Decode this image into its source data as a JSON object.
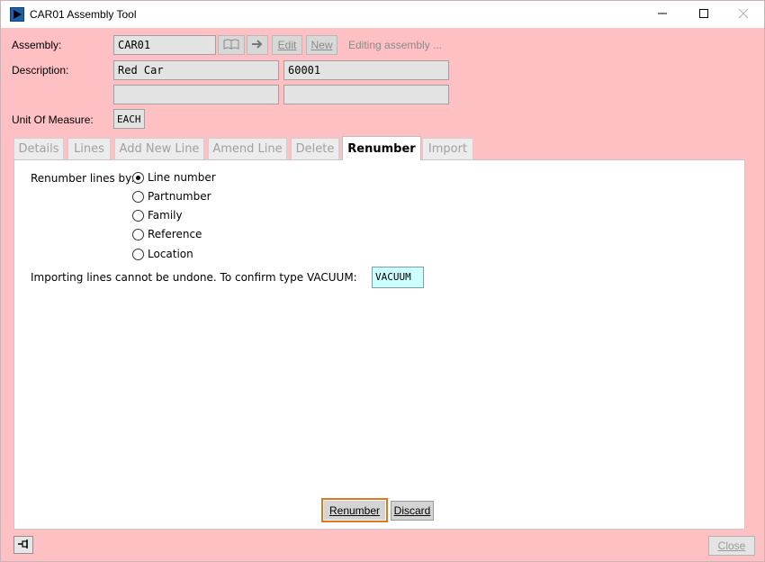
{
  "window": {
    "title": "CAR01 Assembly Tool",
    "app_icon": "play-icon",
    "controls": [
      "minimize-icon",
      "maximize-icon",
      "close-icon"
    ]
  },
  "header": {
    "assembly_label": "Assembly:",
    "assembly_value": "CAR01",
    "description_label": "Description:",
    "description_value": "Red Car",
    "code_value": "60001",
    "extra1_value": "",
    "extra2_value": "",
    "uom_label": "Unit Of Measure:",
    "uom_value": "EACH",
    "lookup_icon": "book-icon",
    "go_icon": "arrow-right-icon",
    "edit_label": "Edit",
    "new_label": "New",
    "status_text": "Editing assembly ..."
  },
  "tabs": [
    {
      "label": "Details",
      "active": false
    },
    {
      "label": "Lines",
      "active": false
    },
    {
      "label": "Add New Line",
      "active": false
    },
    {
      "label": "Amend Line",
      "active": false
    },
    {
      "label": "Delete",
      "active": false
    },
    {
      "label": "Renumber",
      "active": true
    },
    {
      "label": "Import",
      "active": false
    }
  ],
  "renumber": {
    "by_label": "Renumber lines by:",
    "options": [
      {
        "label": "Line number",
        "checked": true
      },
      {
        "label": "Partnumber",
        "checked": false
      },
      {
        "label": "Family",
        "checked": false
      },
      {
        "label": "Reference",
        "checked": false
      },
      {
        "label": "Location",
        "checked": false
      }
    ],
    "confirm_text": "Importing lines cannot be undone.  To confirm type VACUUM:",
    "confirm_value": "VACUUM"
  },
  "actions": {
    "renumber_label": "Renumber",
    "discard_label": "Discard",
    "close_label": "Close"
  },
  "colors": {
    "background": "#ffc0c4",
    "confirm_field": "#ccffff",
    "focus_border": "#e07820"
  }
}
